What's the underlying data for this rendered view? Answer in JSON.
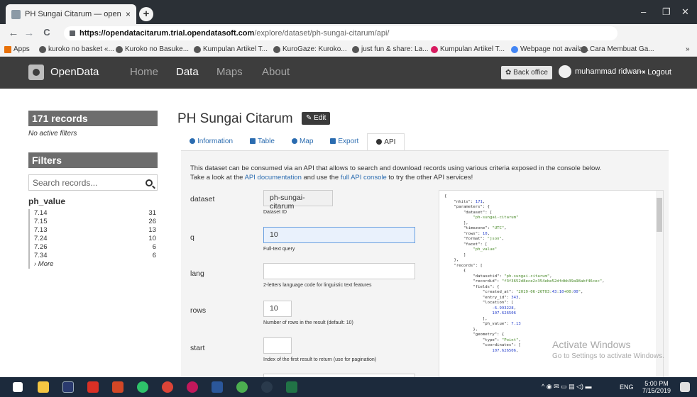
{
  "browser": {
    "tab_title": "PH Sungai Citarum — opendatac",
    "tab_close": "×",
    "newtab": "+",
    "url_domain": "https://opendatacitarum.trial.opendatasoft.com",
    "url_path": "/explore/dataset/ph-sungai-citarum/api/",
    "window_buttons": [
      "–",
      "❐",
      "✕"
    ],
    "nav": [
      "←",
      "→",
      "C"
    ],
    "bookmarks": [
      "Apps",
      "kuroko no basket «...",
      "Kuroko no Basuke...",
      "Kumpulan Artikel T...",
      "KuroGaze: Kuroko...",
      "just fun & share: La...",
      "Kumpulan Artikel T...",
      "Webpage not availa...",
      "Cara Membuat Ga..."
    ],
    "bookmarks_more": "»",
    "colors": {
      "chrome": "#2b3036",
      "toolbar": "#f3f3f3"
    }
  },
  "site": {
    "brand": "OpenData",
    "nav": [
      "Home",
      "Data",
      "Maps",
      "About"
    ],
    "active_nav": "Data",
    "back_office": "✿ Back office",
    "username": "muhammad ridwan",
    "logout": "⇥ Logout",
    "colors": {
      "navbar": "#3d3d3d"
    }
  },
  "sidebar": {
    "records": "171 records",
    "no_filters": "No active filters",
    "filters": "Filters",
    "search_placeholder": "Search records...",
    "facet_title": "ph_value",
    "facets": [
      {
        "label": "7.14",
        "count": "31"
      },
      {
        "label": "7.15",
        "count": "26"
      },
      {
        "label": "7.13",
        "count": "13"
      },
      {
        "label": "7.24",
        "count": "10"
      },
      {
        "label": "7.26",
        "count": "6"
      },
      {
        "label": "7.34",
        "count": "6"
      }
    ],
    "more": "› More"
  },
  "main": {
    "title": "PH Sungai Citarum",
    "edit": "✎ Edit",
    "tabs": [
      "Information",
      "Table",
      "Map",
      "Export",
      "API"
    ],
    "active_tab": "API",
    "intro_1": "This dataset can be consumed via an API that allows to search and download records using various criteria exposed in the console below.",
    "intro_2a": "Take a look at the ",
    "intro_link1": "API documentation",
    "intro_2b": " and use the ",
    "intro_link2": "full API console",
    "intro_2c": " to try the other API services!",
    "params": [
      {
        "name": "dataset",
        "value": "ph-sungai-citarum",
        "help": "Dataset ID"
      },
      {
        "name": "q",
        "value": "10",
        "help": "Full-text query"
      },
      {
        "name": "lang",
        "value": "",
        "help": "2-letters language code for linguistic text features"
      },
      {
        "name": "rows",
        "value": "10",
        "help": "Number of rows in the result (default: 10)"
      },
      {
        "name": "start",
        "value": "",
        "help": "Index of the first result to return (use for pagination)"
      }
    ],
    "json_response": [
      "{",
      "    \"nhits\": 171,",
      "    \"parameters\": {",
      "        \"dataset\": [",
      "            \"ph-sungai-citarum\"",
      "        ],",
      "        \"timezone\": \"UTC\",",
      "        \"rows\": 10,",
      "        \"format\": \"json\",",
      "        \"facet\": [",
      "            \"ph_value\"",
      "        ]",
      "    },",
      "    \"records\": [",
      "        {",
      "            \"datasetid\": \"ph-sungai-citarum\",",
      "            \"recordid\": \"f3f3652d8ece2c354ebe52dfdbb39a98abf46cec\",",
      "            \"fields\": {",
      "                \"created_at\": \"2019-06-26T03:43:10+00:00\",",
      "                \"entry_id\": 343,",
      "                \"location\": [",
      "                    -6.993228,",
      "                    107.626506",
      "                ],",
      "                \"ph_value\": 7.13",
      "            },",
      "            \"geometry\": {",
      "                \"type\": \"Point\",",
      "                \"coordinates\": [",
      "                    107.626506,"
    ]
  },
  "watermark": {
    "line1": "Activate Windows",
    "line2": "Go to Settings to activate Windows."
  },
  "taskbar": {
    "time": "5:00 PM",
    "date": "7/15/2019",
    "lang": "ENG",
    "tray": "^ ◉ ✉ ▭ ▤ ◁) ▬",
    "colors": {
      "taskbar": "#1c2a3c"
    }
  }
}
